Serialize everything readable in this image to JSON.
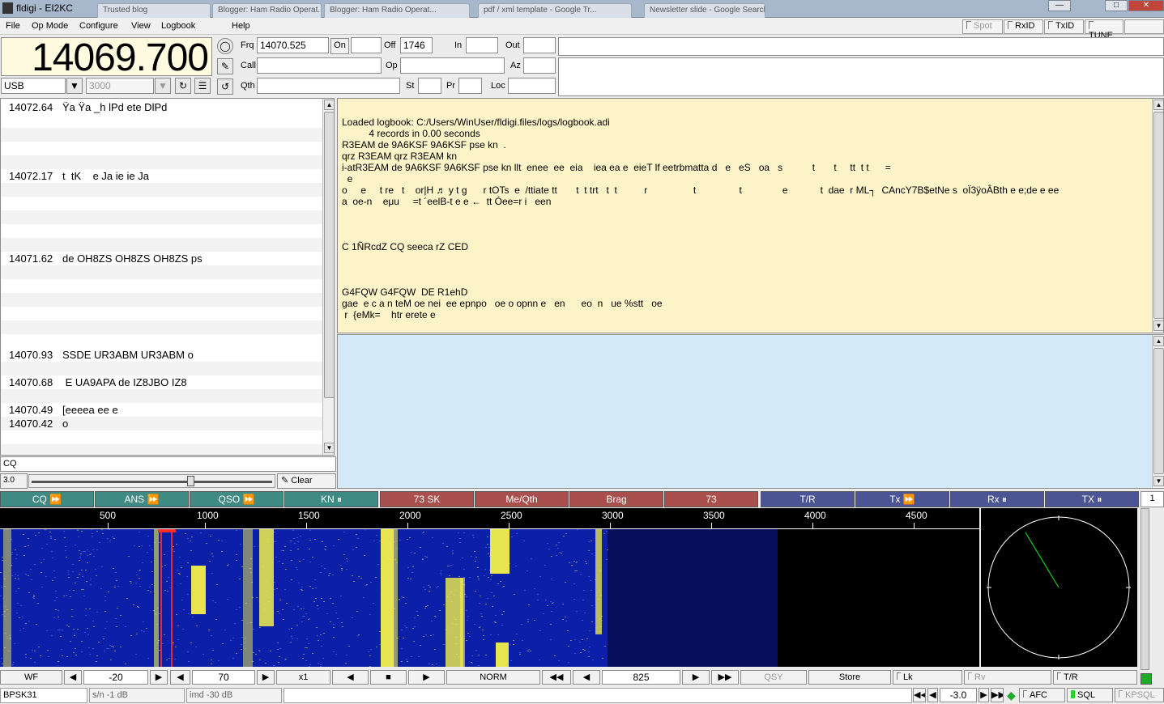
{
  "window": {
    "title": "fldigi - EI2KC",
    "bg_tabs": [
      "Trusted blog",
      "Blogger: Ham Radio Operat...",
      "pdf / xml template - Google Tr...",
      "Newsletter slide - Google Search"
    ]
  },
  "menu": [
    "File",
    "Op Mode",
    "Configure",
    "View",
    "Logbook",
    "Help"
  ],
  "top_buttons": {
    "spot": "Spot",
    "rxid": "RxID",
    "txid": "TxID",
    "tune": "TUNE"
  },
  "freq_display": "14069.700",
  "qso": {
    "frq_label": "Frq",
    "frq_value": "14070.525",
    "on_label": "On",
    "on_value": "",
    "off_label": "Off",
    "off_value": "1746",
    "in_label": "In",
    "in_value": "",
    "out_label": "Out",
    "out_value": "",
    "call_label": "Call",
    "call_value": "",
    "op_label": "Op",
    "op_value": "",
    "az_label": "Az",
    "az_value": "",
    "qth_label": "Qth",
    "qth_value": "",
    "st_label": "St",
    "st_value": "",
    "pr_label": "Pr",
    "pr_value": "",
    "loc_label": "Loc",
    "loc_value": ""
  },
  "mode_select": "USB",
  "bandwidth_select": "3000",
  "browser_rows": [
    {
      "freq": "14072.64",
      "text": "Ÿa Ÿa _h lPd ete DlPd"
    },
    {
      "freq": "14072.17",
      "text": "t  tK    e Ja ie ie Ja"
    },
    {
      "freq": "14071.62",
      "text": "de OH8ZS OH8ZS OH8ZS ps"
    },
    {
      "freq": "14070.93",
      "text": "SSDE UR3ABM UR3ABM o"
    },
    {
      "freq": "14070.68",
      "text": " E UA9APA de IZ8JBO IZ8"
    },
    {
      "freq": "14070.49",
      "text": "[eeeea ee e"
    },
    {
      "freq": "14070.42",
      "text": "o"
    }
  ],
  "search_field": "CQ",
  "squelch_value": "3.0",
  "clear_label": "Clear",
  "rx_lines": [
    "Loaded logbook: C:/Users/WinUser/fldigi.files/logs/logbook.adi",
    "          4 records in 0.00 seconds",
    "R3EAM de 9A6KSF 9A6KSF pse kn  .",
    "qrz R3EAM qrz R3EAM kn",
    "i-atR3EAM de 9A6KSF 9A6KSF pse kn llt  enee  ee  eia    iea ea e  eieT lf eetrbmatta d   e   eS   oa   s           t       t     tt  t t      =",
    "  e",
    "o     e     t re   t    or|H ♬ y t g      r tOTs  e  /ttiate tt       t  t trt   t  t          r                 t                t               e            t  dae  r ML┐  CAncY7B$etNe s  oÏ3ÿoÂBth e e;de e ee",
    "a  oe-n    eμu     =t ´eelB-t e e ←  tt Óee=r i   een",
    "",
    "",
    "",
    "C 1ÑRcdZ CQ seeca rZ CED",
    "",
    "",
    "",
    "G4FQW G4FQW  DE R1ehD",
    "gae  e c a n teM oe nei  ee epnpo   oe o opnn e   en      eo  n   ue %stt   oe",
    " r  {eMk=    htr erete e"
  ],
  "macros": [
    {
      "label": "CQ ⏩",
      "c": "g"
    },
    {
      "label": "ANS ⏩",
      "c": "g"
    },
    {
      "label": "QSO ⏩",
      "c": "g"
    },
    {
      "label": "KN ⏸",
      "c": "g"
    },
    {
      "label": "73 SK",
      "c": "r"
    },
    {
      "label": "Me/Qth",
      "c": "r"
    },
    {
      "label": "Brag",
      "c": "r"
    },
    {
      "label": "73",
      "c": "r"
    },
    {
      "label": "T/R",
      "c": "b"
    },
    {
      "label": "Tx ⏩",
      "c": "b"
    },
    {
      "label": "Rx ⏸",
      "c": "b"
    },
    {
      "label": "TX ⏸",
      "c": "b"
    }
  ],
  "macro_set": "1",
  "scale_ticks": [
    "500",
    "1000",
    "1500",
    "2000",
    "2500",
    "3000",
    "3500",
    "4000",
    "4500"
  ],
  "waterfall_controls": {
    "wf": "WF",
    "ref_level": "-20",
    "range": "70",
    "zoom": "x1",
    "norm": "NORM",
    "carrier": "825",
    "qsy": "QSY",
    "store": "Store",
    "lk": "Lk",
    "rv": "Rv",
    "tr": "T/R"
  },
  "status": {
    "mode": "BPSK31",
    "sn": "s/n -1 dB",
    "imd": "imd -30 dB",
    "afc_offset": "-3.0",
    "afc": "AFC",
    "sql": "SQL",
    "kpsql": "KPSQL"
  },
  "colors": {
    "wf_blue": "#0c1fa8",
    "wf_yellow": "#f2f04a",
    "rx_bg": "#fdf3c8",
    "tx_bg": "#d3e9f8",
    "cursor_red": "#ff2a2a"
  }
}
